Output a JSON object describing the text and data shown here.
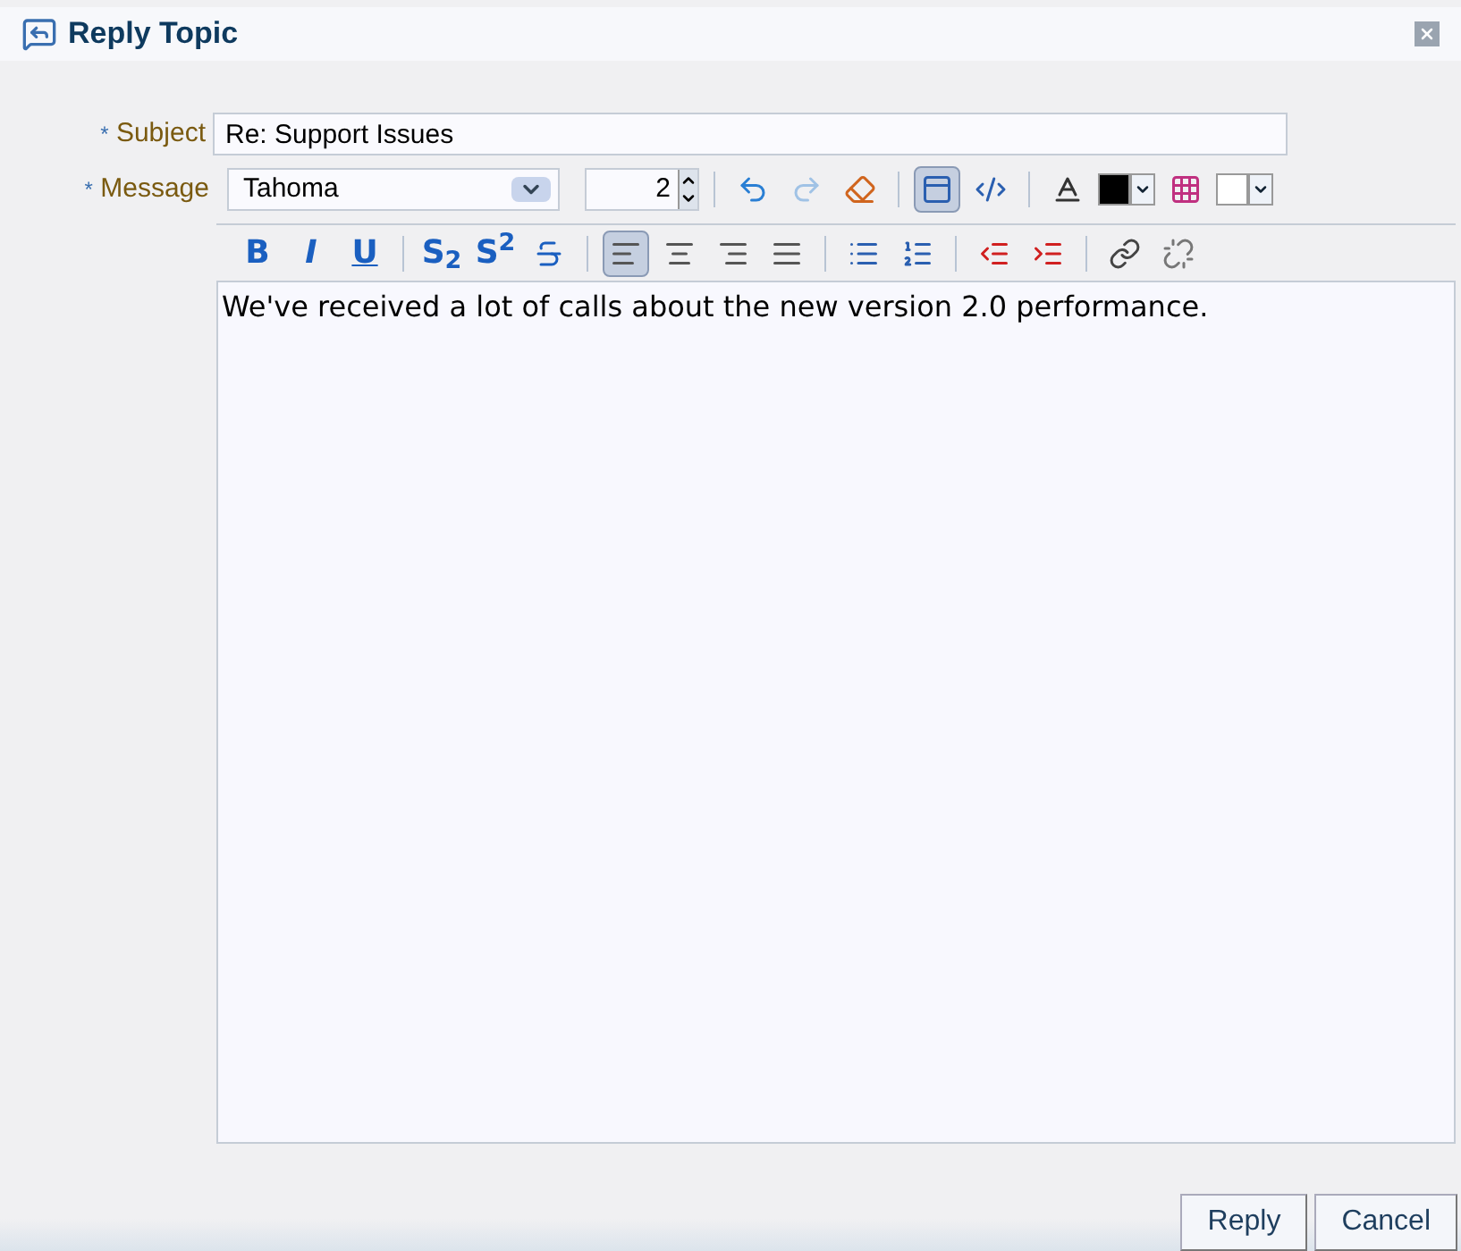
{
  "dialog": {
    "title": "Reply Topic"
  },
  "subject": {
    "label": "Subject",
    "required_mark": "*",
    "value": "Re: Support Issues"
  },
  "message": {
    "label": "Message",
    "required_mark": "*",
    "font": "Tahoma",
    "size": "2",
    "body": "We've received a lot of calls about the new version 2.0 performance."
  },
  "toolbar_top": [
    {
      "kind": "undo",
      "disabled": false,
      "selected": false
    },
    {
      "kind": "redo",
      "disabled": true,
      "selected": false
    },
    {
      "kind": "eraser",
      "disabled": false,
      "selected": false
    },
    {
      "kind": "separator"
    },
    {
      "kind": "rich-view",
      "disabled": false,
      "selected": true
    },
    {
      "kind": "source-view",
      "disabled": false,
      "selected": false
    },
    {
      "kind": "separator"
    },
    {
      "kind": "text-color",
      "disabled": false,
      "selected": false
    },
    {
      "kind": "swatch",
      "color": "#000000"
    },
    {
      "kind": "palette",
      "disabled": false,
      "selected": false
    },
    {
      "kind": "swatch",
      "color": "#ffffff"
    }
  ],
  "toolbar_bottom": [
    {
      "kind": "bold",
      "label": "B",
      "selected": false
    },
    {
      "kind": "italic",
      "label": "I",
      "selected": false
    },
    {
      "kind": "underline",
      "label": "U",
      "selected": false
    },
    {
      "kind": "separator"
    },
    {
      "kind": "script",
      "label": "S$_{2}$",
      "selected": false
    },
    {
      "kind": "script",
      "label": "S$^{2}$",
      "selected": false
    },
    {
      "kind": "strike",
      "selected": false
    },
    {
      "kind": "separator"
    },
    {
      "kind": "align-left",
      "selected": true
    },
    {
      "kind": "align-center",
      "selected": false
    },
    {
      "kind": "align-right",
      "selected": false
    },
    {
      "kind": "align-justify",
      "selected": false
    },
    {
      "kind": "separator"
    },
    {
      "kind": "bullets",
      "selected": false
    },
    {
      "kind": "numbers",
      "selected": false
    },
    {
      "kind": "separator"
    },
    {
      "kind": "outdent",
      "selected": false
    },
    {
      "kind": "indent",
      "selected": false
    },
    {
      "kind": "separator"
    },
    {
      "kind": "link",
      "selected": false
    },
    {
      "kind": "unlink",
      "selected": false
    }
  ],
  "buttons": [
    "Reply",
    "Cancel"
  ]
}
